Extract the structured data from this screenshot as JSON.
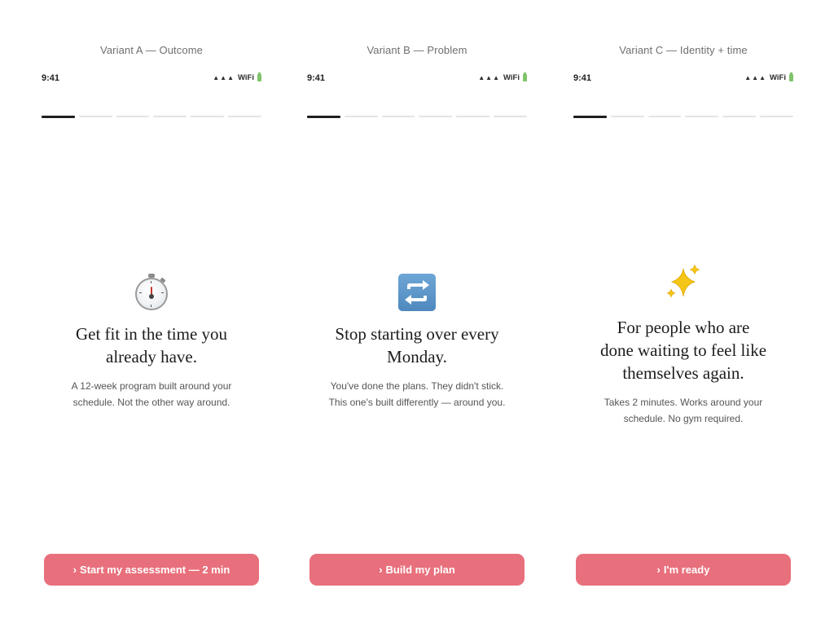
{
  "variants": [
    {
      "label": "Variant A — Outcome",
      "status": {
        "time": "9:41",
        "signal": "▲▲▲",
        "wifi": "WiFi",
        "battery_icon": "battery-icon"
      },
      "progress": {
        "total_steps": 6,
        "current_step": 1
      },
      "icon": "stopwatch-icon",
      "headline_line1": "Get fit in the time you",
      "headline_line2": "already have.",
      "subtext_line1": "A 12-week program built around your",
      "subtext_line2": "schedule. Not the other way around.",
      "cta_label": "Start my assessment — 2 min",
      "cta_chevron": "›"
    },
    {
      "label": "Variant B — Problem",
      "status": {
        "time": "9:41",
        "signal": "▲▲▲",
        "wifi": "WiFi",
        "battery_icon": "battery-icon"
      },
      "progress": {
        "total_steps": 6,
        "current_step": 1
      },
      "icon": "repeat-icon",
      "headline_line1": "Stop starting over every",
      "headline_line2": "Monday.",
      "subtext_line1": "You've done the plans. They didn't stick.",
      "subtext_line2": "This one's built differently — around you.",
      "cta_label": "Build my plan",
      "cta_chevron": "›"
    },
    {
      "label": "Variant C — Identity + time",
      "status": {
        "time": "9:41",
        "signal": "▲▲▲",
        "wifi": "WiFi",
        "battery_icon": "battery-icon"
      },
      "progress": {
        "total_steps": 6,
        "current_step": 1
      },
      "icon": "sparkles-icon",
      "headline_line1": "For people who are",
      "headline_line2": "done waiting to feel like",
      "headline_line3": "themselves again.",
      "subtext_line1": "Takes 2 minutes. Works around your",
      "subtext_line2": "schedule. No gym required.",
      "cta_label": "I'm ready",
      "cta_chevron": "›"
    }
  ],
  "colors": {
    "cta_background": "#e8707c",
    "progress_active": "#1f1f1f",
    "progress_inactive": "#e4e4e4",
    "battery": "#7fc36a"
  }
}
